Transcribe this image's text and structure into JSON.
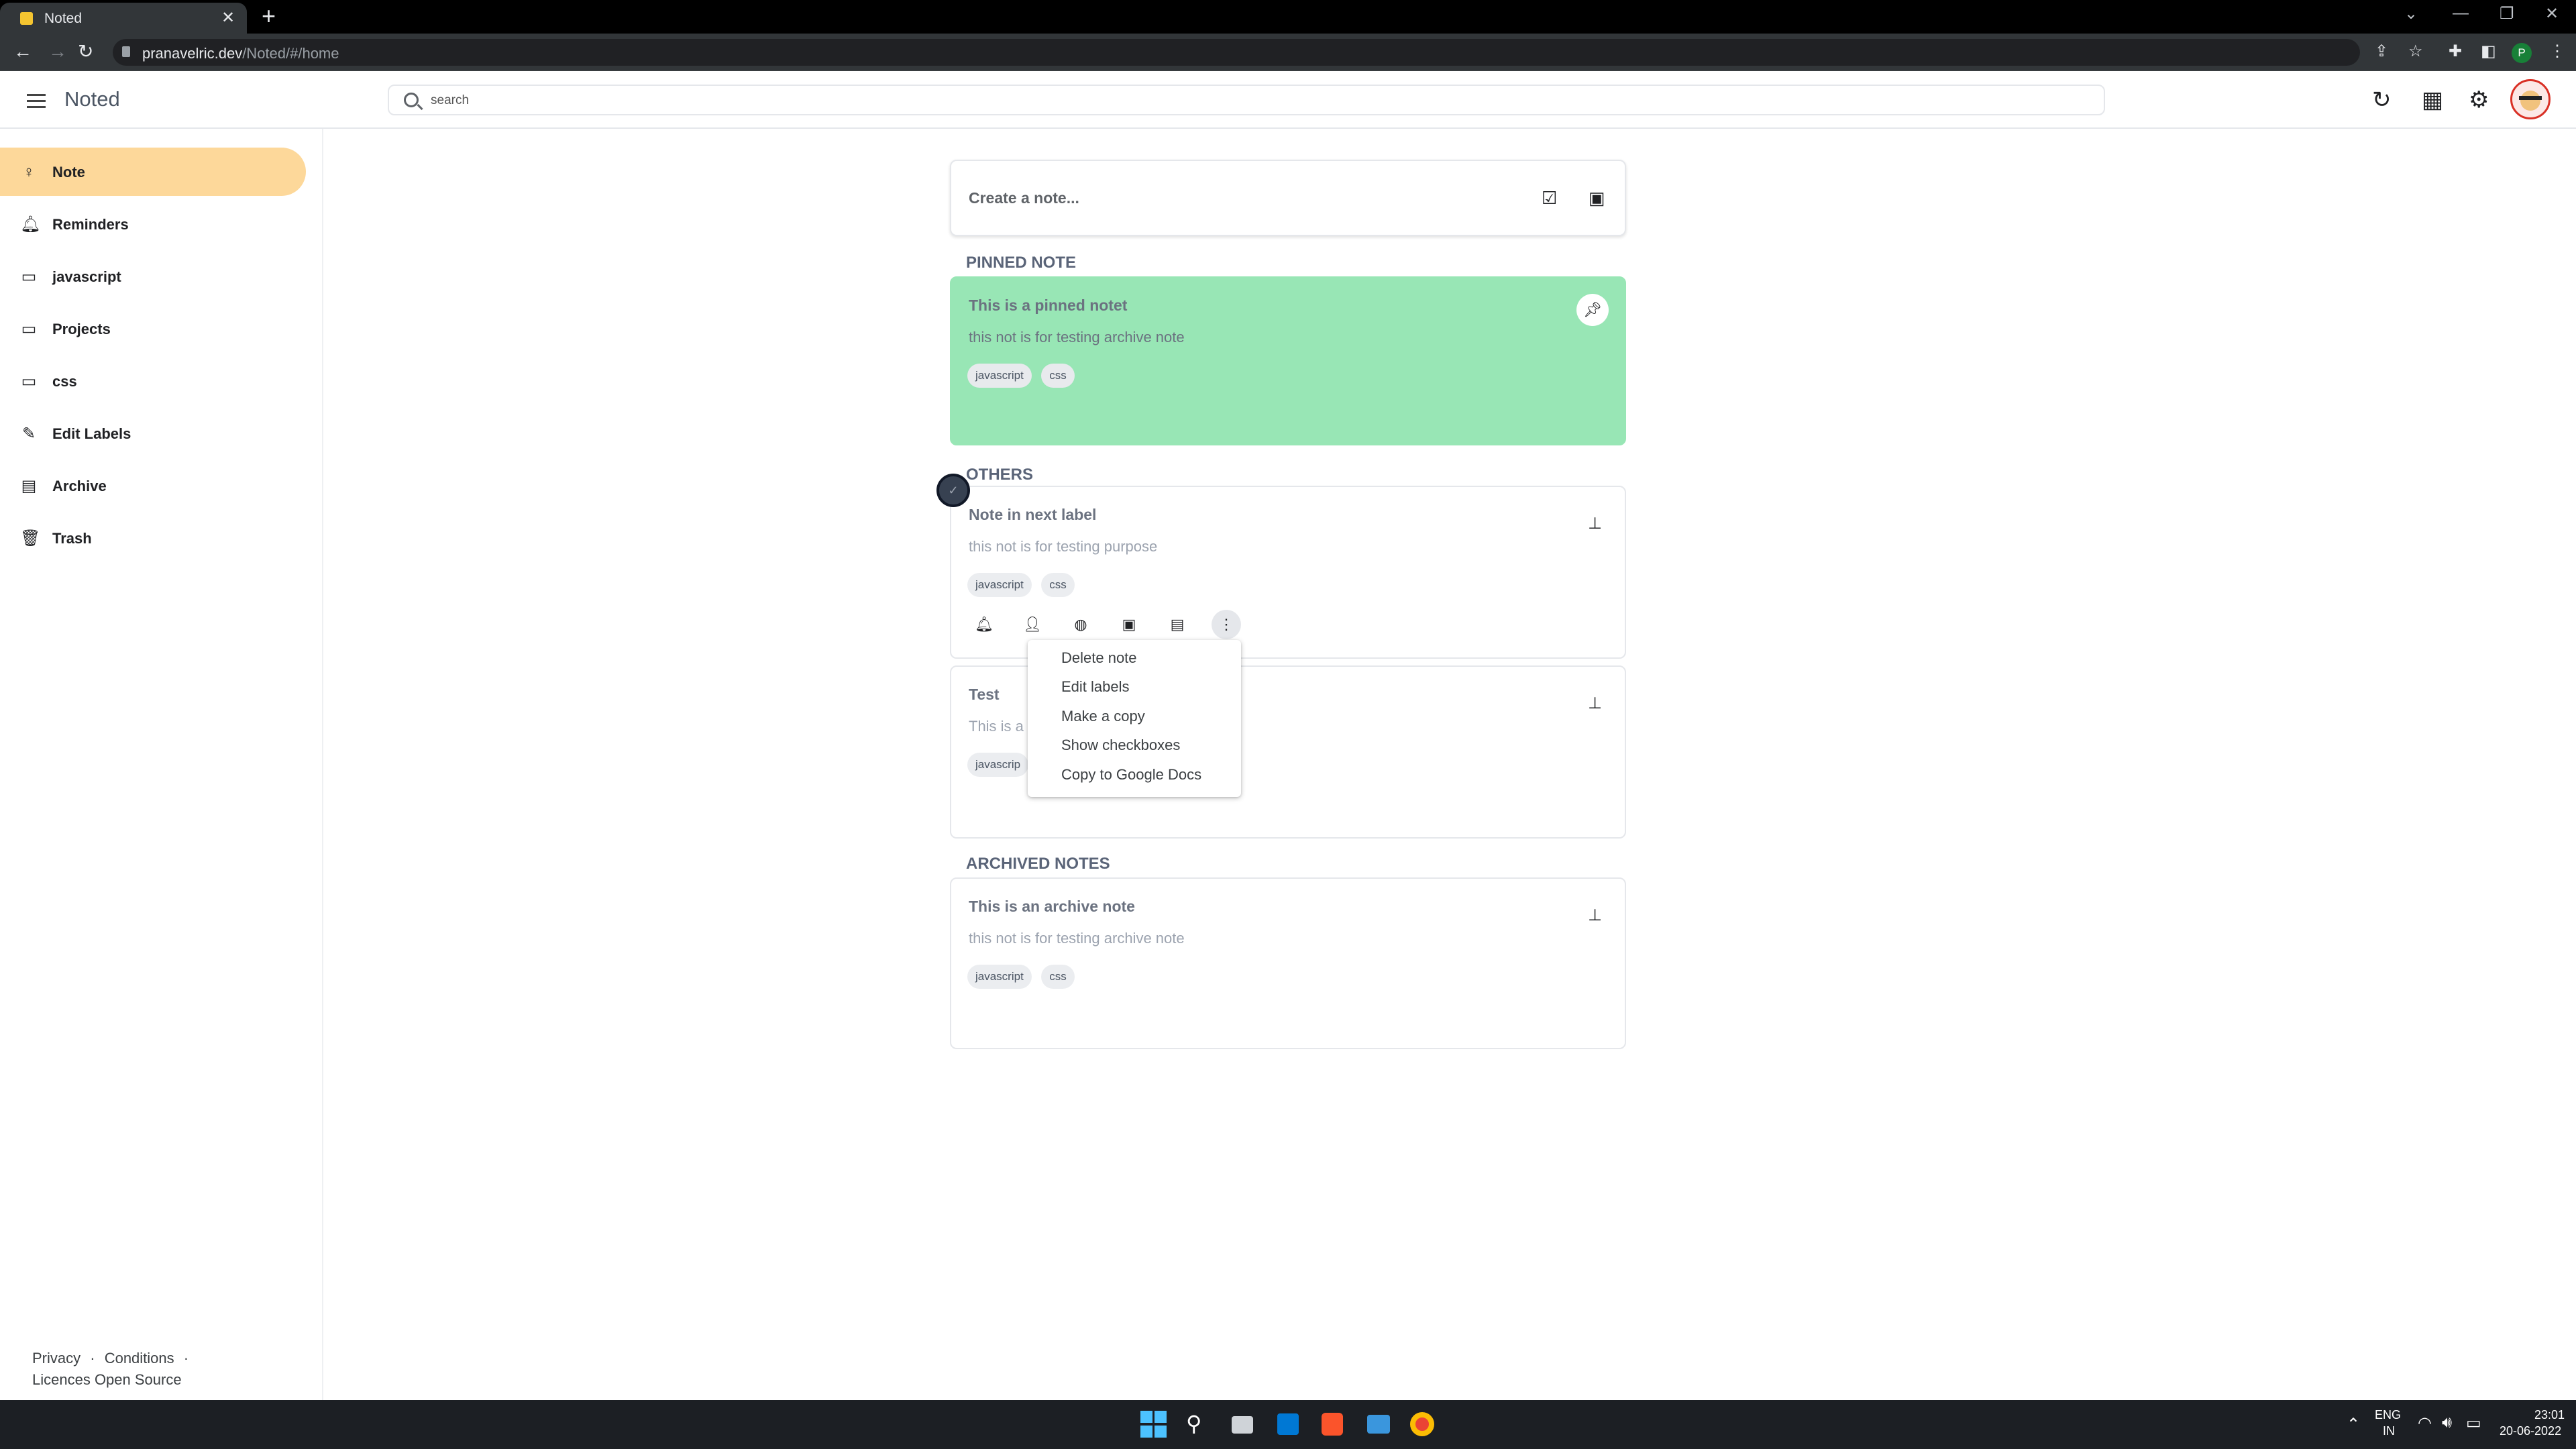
{
  "browser": {
    "tab_title": "Noted",
    "tab_close": "✕",
    "new_tab": "+",
    "url_host": "pranavelric.dev",
    "url_path": "/Noted/#/home",
    "profile_initial": "P"
  },
  "header": {
    "app_name": "Noted",
    "search_placeholder": "search"
  },
  "sidebar": {
    "items": [
      {
        "label": "Note",
        "icon": "lightbulb-icon"
      },
      {
        "label": "Reminders",
        "icon": "bell-icon"
      },
      {
        "label": "javascript",
        "icon": "label-icon"
      },
      {
        "label": "Projects",
        "icon": "label-icon"
      },
      {
        "label": "css",
        "icon": "label-icon"
      },
      {
        "label": "Edit Labels",
        "icon": "pencil-icon"
      },
      {
        "label": "Archive",
        "icon": "archive-icon"
      },
      {
        "label": "Trash",
        "icon": "trash-icon"
      }
    ],
    "footer": {
      "privacy": "Privacy",
      "sep1": "·",
      "conditions": "Conditions",
      "sep2": "·",
      "licences": "Licences Open Source"
    }
  },
  "main": {
    "create_placeholder": "Create a note...",
    "pinned_heading": "PINNED NOTE",
    "others_heading": "OTHERS",
    "archived_heading": "ARCHIVED NOTES",
    "pinned_note": {
      "title": "This is a pinned notet",
      "body": "this not is for testing archive note",
      "tags": [
        "javascript",
        "css"
      ]
    },
    "note1": {
      "title": "Note in next label",
      "body": "this not is for testing purpose",
      "tags": [
        "javascript",
        "css"
      ]
    },
    "note2": {
      "title": "Test",
      "body": "This is a t",
      "tags": [
        "javascrip"
      ]
    },
    "archived_note": {
      "title": "This is an archive note",
      "body": "this not is for testing archive note",
      "tags": [
        "javascript",
        "css"
      ]
    },
    "context_menu": [
      "Delete note",
      "Edit labels",
      "Make a copy",
      "Show checkboxes",
      "Copy to Google Docs"
    ]
  },
  "taskbar": {
    "lang": "ENG",
    "region": "IN",
    "time": "23:01",
    "date": "20-06-2022"
  },
  "colors": {
    "active_nav": "#fdd89a",
    "pinned_note_bg": "#98e6b5"
  }
}
